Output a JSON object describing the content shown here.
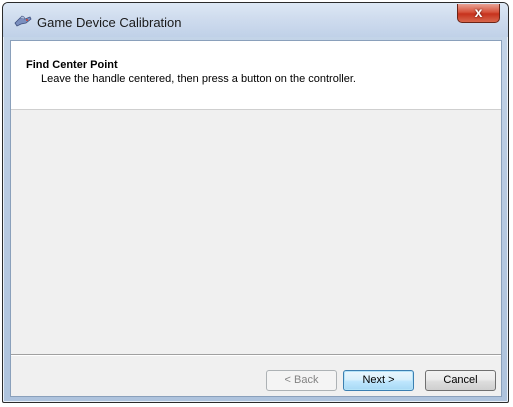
{
  "window": {
    "title": "Game Device Calibration",
    "close_glyph": "x"
  },
  "header": {
    "title": "Find Center Point",
    "subtitle": "Leave the handle centered, then press a button on the controller."
  },
  "buttons": {
    "back": "< Back",
    "next": "Next >",
    "cancel": "Cancel"
  },
  "icons": {
    "title_icon": "game-controller-icon"
  },
  "colors": {
    "close_button": "#c7321d",
    "client_background": "#f0f0f0",
    "header_background": "#ffffff"
  }
}
